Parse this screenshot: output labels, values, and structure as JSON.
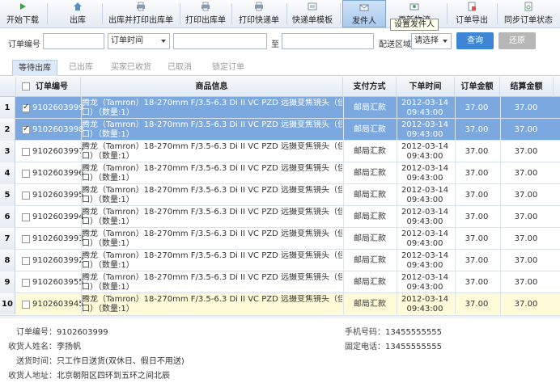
{
  "toolbar": {
    "buttons": [
      {
        "label": "开始下载",
        "icon": "play-icon"
      },
      {
        "label": "出库",
        "icon": "home-icon"
      },
      {
        "label": "出库并打印出库单",
        "icon": "print-outbound-icon"
      },
      {
        "label": "打印出库单",
        "icon": "printer-icon"
      },
      {
        "label": "打印快递单",
        "icon": "printer-icon"
      },
      {
        "label": "快递单模板",
        "icon": "template-icon"
      },
      {
        "label": "发件人",
        "icon": "sender-icon"
      },
      {
        "label": "更新物流",
        "icon": "refresh-icon"
      },
      {
        "label": "订单导出",
        "icon": "export-icon"
      },
      {
        "label": "同步订单状态",
        "icon": "sync-icon"
      }
    ],
    "tooltip": "设置发件人"
  },
  "filter": {
    "order_no_label": "订单编号",
    "order_no_value": "",
    "time_select": "订单时间",
    "to_label": "至",
    "region_label": "配送区域",
    "region_select": "请选择",
    "query_label": "查询",
    "reset_label": "还原"
  },
  "tabs": [
    "等待出库",
    "已出库",
    "买家已收货",
    "已取消",
    "锁定订单"
  ],
  "table": {
    "headers": {
      "order_no": "订单编号",
      "product": "商品信息",
      "payment": "支付方式",
      "order_time": "下单时间",
      "amount": "订单金额",
      "settle": "结算金额"
    },
    "rows": [
      {
        "n": "1",
        "checked": true,
        "order_no": "9102603999",
        "product_l1": "腾龙（Tamron）18-270mm F/3.5-6.3 Di II VC PZD 远摄变焦镜头（佳能卡",
        "product_l2": "口）（数量:1）",
        "payment": "邮局汇款",
        "date": "2012-03-14",
        "time": "09:43:00",
        "amount": "37.00",
        "settle": "37.00"
      },
      {
        "n": "2",
        "checked": true,
        "order_no": "9102603998",
        "product_l1": "腾龙（Tamron）18-270mm F/3.5-6.3 Di II VC PZD 远摄变焦镜头（佳能卡",
        "product_l2": "口）（数量:1）",
        "payment": "邮局汇款",
        "date": "2012-03-14",
        "time": "09:43:00",
        "amount": "37.00",
        "settle": "37.00"
      },
      {
        "n": "3",
        "checked": false,
        "order_no": "9102603997",
        "product_l1": "腾龙（Tamron）18-270mm F/3.5-6.3 Di II VC PZD 远摄变焦镜头（佳能卡",
        "product_l2": "口）（数量:1）",
        "payment": "邮局汇款",
        "date": "2012-03-14",
        "time": "09:43:00",
        "amount": "37.00",
        "settle": "37.00"
      },
      {
        "n": "4",
        "checked": false,
        "order_no": "9102603996",
        "product_l1": "腾龙（Tamron）18-270mm F/3.5-6.3 Di II VC PZD 远摄变焦镜头（佳能卡",
        "product_l2": "口）（数量:1）",
        "payment": "邮局汇款",
        "date": "2012-03-14",
        "time": "09:43:00",
        "amount": "37.00",
        "settle": "37.00"
      },
      {
        "n": "5",
        "checked": false,
        "order_no": "9102603995",
        "product_l1": "腾龙（Tamron）18-270mm F/3.5-6.3 Di II VC PZD 远摄变焦镜头（佳能卡",
        "product_l2": "口）（数量:1）",
        "payment": "邮局汇款",
        "date": "2012-03-14",
        "time": "09:43:00",
        "amount": "37.00",
        "settle": "37.00"
      },
      {
        "n": "6",
        "checked": false,
        "order_no": "9102603994",
        "product_l1": "腾龙（Tamron）18-270mm F/3.5-6.3 Di II VC PZD 远摄变焦镜头（佳能卡",
        "product_l2": "口）（数量:1）",
        "payment": "邮局汇款",
        "date": "2012-03-14",
        "time": "09:43:00",
        "amount": "37.00",
        "settle": "37.00"
      },
      {
        "n": "7",
        "checked": false,
        "order_no": "9102603993",
        "product_l1": "腾龙（Tamron）18-270mm F/3.5-6.3 Di II VC PZD 远摄变焦镜头（佳能卡",
        "product_l2": "口）（数量:1）",
        "payment": "邮局汇款",
        "date": "2012-03-14",
        "time": "09:43:00",
        "amount": "37.00",
        "settle": "37.00"
      },
      {
        "n": "8",
        "checked": false,
        "order_no": "9102603992",
        "product_l1": "腾龙（Tamron）18-270mm F/3.5-6.3 Di II VC PZD 远摄变焦镜头（佳能卡",
        "product_l2": "口）（数量:1）",
        "payment": "邮局汇款",
        "date": "2012-03-14",
        "time": "09:43:00",
        "amount": "37.00",
        "settle": "37.00"
      },
      {
        "n": "9",
        "checked": false,
        "order_no": "9102603955",
        "product_l1": "腾龙（Tamron）18-270mm F/3.5-6.3 Di II VC PZD 远摄变焦镜头（佳能卡",
        "product_l2": "口）（数量:1）",
        "payment": "邮局汇款",
        "date": "2012-03-14",
        "time": "09:43:00",
        "amount": "37.00",
        "settle": "37.00"
      },
      {
        "n": "10",
        "checked": false,
        "order_no": "9102603945",
        "product_l1": "腾龙（Tamron）18-270mm F/3.5-6.3 Di II VC PZD 远摄变焦镜头（佳能卡",
        "product_l2": "口）（数量:1）",
        "payment": "邮局汇款",
        "date": "2012-03-14",
        "time": "09:43:00",
        "amount": "37.00",
        "settle": "37.00"
      }
    ]
  },
  "detail": {
    "order_no_label": "订单编号：",
    "order_no": "9102603999",
    "receiver_label": "收货人姓名：",
    "receiver": "李扬帆",
    "delivery_label": "送货时间：",
    "delivery": "只工作日送货(双休日、假日不用送)",
    "address_label": "收货人地址：",
    "address": "北京朝阳区四环到五环之间北辰",
    "mobile_label": "手机号码：",
    "mobile": "13455555555",
    "phone_label": "固定电话：",
    "phone": "13455555555"
  },
  "colors": {
    "accent": "#3d86d6",
    "selected_row": "#7ba8de",
    "hover_row": "#fffbd9"
  }
}
